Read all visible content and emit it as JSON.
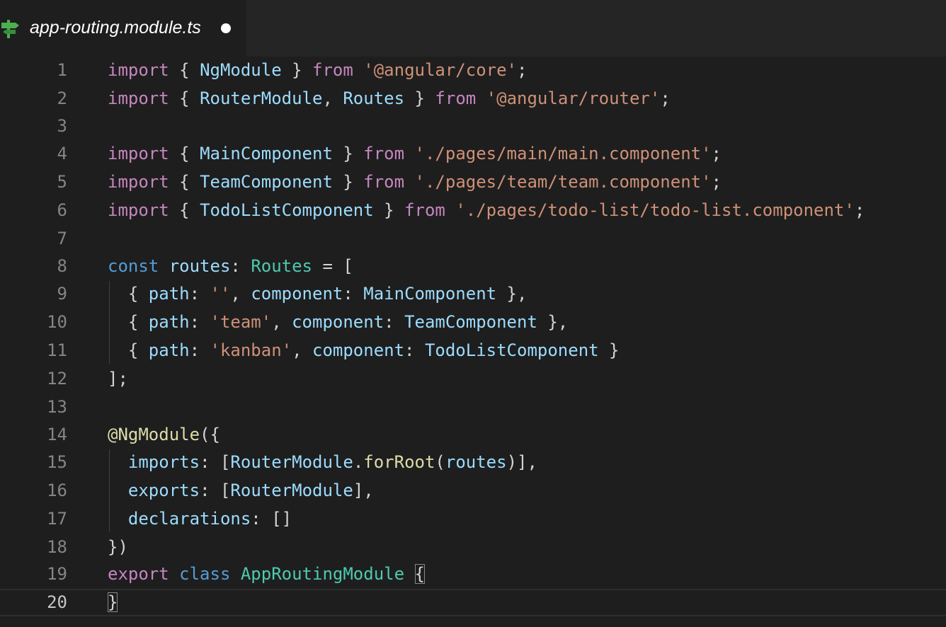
{
  "tab": {
    "title": "app-routing.module.ts",
    "icon": "angular-routing-icon",
    "dirty": true
  },
  "colors": {
    "keyword": "#c586c0",
    "storage": "#569cd6",
    "variable": "#9cdcfe",
    "type": "#4ec9b0",
    "function": "#dcdcaa",
    "string": "#ce9178",
    "punctuation": "#d4d4d4"
  },
  "current_line": 20,
  "lines": [
    {
      "number": "1",
      "tokens": [
        [
          "kw",
          "import"
        ],
        [
          "punc",
          " { "
        ],
        [
          "var",
          "NgModule"
        ],
        [
          "punc",
          " } "
        ],
        [
          "kw",
          "from"
        ],
        [
          "punc",
          " "
        ],
        [
          "str",
          "'@angular/core'"
        ],
        [
          "punc",
          ";"
        ]
      ]
    },
    {
      "number": "2",
      "tokens": [
        [
          "kw",
          "import"
        ],
        [
          "punc",
          " { "
        ],
        [
          "var",
          "RouterModule"
        ],
        [
          "punc",
          ", "
        ],
        [
          "var",
          "Routes"
        ],
        [
          "punc",
          " } "
        ],
        [
          "kw",
          "from"
        ],
        [
          "punc",
          " "
        ],
        [
          "str",
          "'@angular/router'"
        ],
        [
          "punc",
          ";"
        ]
      ]
    },
    {
      "number": "3",
      "tokens": []
    },
    {
      "number": "4",
      "tokens": [
        [
          "kw",
          "import"
        ],
        [
          "punc",
          " { "
        ],
        [
          "var",
          "MainComponent"
        ],
        [
          "punc",
          " } "
        ],
        [
          "kw",
          "from"
        ],
        [
          "punc",
          " "
        ],
        [
          "str",
          "'./pages/main/main.component'"
        ],
        [
          "punc",
          ";"
        ]
      ]
    },
    {
      "number": "5",
      "tokens": [
        [
          "kw",
          "import"
        ],
        [
          "punc",
          " { "
        ],
        [
          "var",
          "TeamComponent"
        ],
        [
          "punc",
          " } "
        ],
        [
          "kw",
          "from"
        ],
        [
          "punc",
          " "
        ],
        [
          "str",
          "'./pages/team/team.component'"
        ],
        [
          "punc",
          ";"
        ]
      ]
    },
    {
      "number": "6",
      "tokens": [
        [
          "kw",
          "import"
        ],
        [
          "punc",
          " { "
        ],
        [
          "var",
          "TodoListComponent"
        ],
        [
          "punc",
          " } "
        ],
        [
          "kw",
          "from"
        ],
        [
          "punc",
          " "
        ],
        [
          "str",
          "'./pages/todo-list/todo-list.component'"
        ],
        [
          "punc",
          ";"
        ]
      ]
    },
    {
      "number": "7",
      "tokens": []
    },
    {
      "number": "8",
      "tokens": [
        [
          "kw2",
          "const"
        ],
        [
          "punc",
          " "
        ],
        [
          "var",
          "routes"
        ],
        [
          "punc",
          ": "
        ],
        [
          "type",
          "Routes"
        ],
        [
          "punc",
          " = ["
        ]
      ]
    },
    {
      "number": "9",
      "tokens": [
        [
          "punc",
          "  { "
        ],
        [
          "var",
          "path"
        ],
        [
          "punc",
          ": "
        ],
        [
          "str",
          "''"
        ],
        [
          "punc",
          ", "
        ],
        [
          "var",
          "component"
        ],
        [
          "punc",
          ": "
        ],
        [
          "var",
          "MainComponent"
        ],
        [
          "punc",
          " },"
        ]
      ]
    },
    {
      "number": "10",
      "tokens": [
        [
          "punc",
          "  { "
        ],
        [
          "var",
          "path"
        ],
        [
          "punc",
          ": "
        ],
        [
          "str",
          "'team'"
        ],
        [
          "punc",
          ", "
        ],
        [
          "var",
          "component"
        ],
        [
          "punc",
          ": "
        ],
        [
          "var",
          "TeamComponent"
        ],
        [
          "punc",
          " },"
        ]
      ]
    },
    {
      "number": "11",
      "tokens": [
        [
          "punc",
          "  { "
        ],
        [
          "var",
          "path"
        ],
        [
          "punc",
          ": "
        ],
        [
          "str",
          "'kanban'"
        ],
        [
          "punc",
          ", "
        ],
        [
          "var",
          "component"
        ],
        [
          "punc",
          ": "
        ],
        [
          "var",
          "TodoListComponent"
        ],
        [
          "punc",
          " }"
        ]
      ]
    },
    {
      "number": "12",
      "tokens": [
        [
          "punc",
          "];"
        ]
      ]
    },
    {
      "number": "13",
      "tokens": []
    },
    {
      "number": "14",
      "tokens": [
        [
          "fn",
          "@NgModule"
        ],
        [
          "punc",
          "({"
        ]
      ]
    },
    {
      "number": "15",
      "tokens": [
        [
          "punc",
          "  "
        ],
        [
          "var",
          "imports"
        ],
        [
          "punc",
          ": ["
        ],
        [
          "var",
          "RouterModule"
        ],
        [
          "punc",
          "."
        ],
        [
          "fn",
          "forRoot"
        ],
        [
          "punc",
          "("
        ],
        [
          "var",
          "routes"
        ],
        [
          "punc",
          ")],"
        ]
      ]
    },
    {
      "number": "16",
      "tokens": [
        [
          "punc",
          "  "
        ],
        [
          "var",
          "exports"
        ],
        [
          "punc",
          ": ["
        ],
        [
          "var",
          "RouterModule"
        ],
        [
          "punc",
          "],"
        ]
      ]
    },
    {
      "number": "17",
      "tokens": [
        [
          "punc",
          "  "
        ],
        [
          "var",
          "declarations"
        ],
        [
          "punc",
          ": []"
        ]
      ]
    },
    {
      "number": "18",
      "tokens": [
        [
          "punc",
          "})"
        ]
      ]
    },
    {
      "number": "19",
      "tokens": [
        [
          "kw",
          "export"
        ],
        [
          "punc",
          " "
        ],
        [
          "kw2",
          "class"
        ],
        [
          "punc",
          " "
        ],
        [
          "type",
          "AppRoutingModule"
        ],
        [
          "punc",
          " "
        ],
        [
          "bracket",
          "{"
        ]
      ]
    },
    {
      "number": "20",
      "tokens": [
        [
          "bracket",
          "}"
        ]
      ]
    }
  ]
}
